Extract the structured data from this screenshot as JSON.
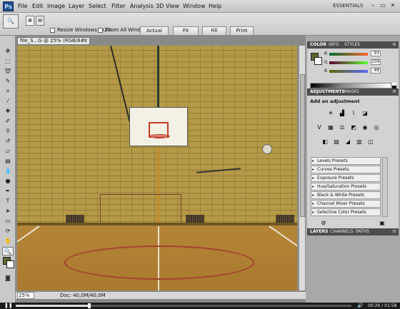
{
  "app": {
    "logo": "Ps",
    "zoom": "25%",
    "workspace": "ESSENTIALS"
  },
  "menu": [
    "File",
    "Edit",
    "Image",
    "Layer",
    "Select",
    "Filter",
    "Analysis",
    "3D",
    "View",
    "Window",
    "Help"
  ],
  "window_controls": [
    "–",
    "▭",
    "✕"
  ],
  "options": {
    "resize_windows": "Resize Windows To Fit",
    "zoom_all": "Zoom All Windows",
    "actual_pixels": "Actual Pixels",
    "fit_screen": "Fit Screen",
    "fill_screen": "Fill Screen",
    "print_size": "Print Size"
  },
  "document": {
    "tab_title": "file_S...G @ 25% (RGB/8#)",
    "status_zoom": "25%",
    "status_doc": "Doc: 40,0M/40,0M"
  },
  "color_panel": {
    "tabs": [
      "COLOR",
      "INFO",
      "STYLES"
    ],
    "r_label": "R",
    "g_label": "G",
    "b_label": "B",
    "r": "93",
    "g": "104",
    "b": "48",
    "fg_color": "#5d6830"
  },
  "adjustments_panel": {
    "tabs": [
      "ADJUSTMENTS",
      "MASKS"
    ],
    "title": "Add an adjustment",
    "presets": [
      "Levels Presets",
      "Curves Presets",
      "Exposure Presets",
      "Hue/Saturation Presets",
      "Black & White Presets",
      "Channel Mixer Presets",
      "Selective Color Presets"
    ]
  },
  "layers_panel": {
    "tabs": [
      "LAYERS",
      "CHANNELS",
      "PATHS"
    ]
  },
  "video": {
    "time": "00:26 / 01:58",
    "progress": 0.22
  }
}
